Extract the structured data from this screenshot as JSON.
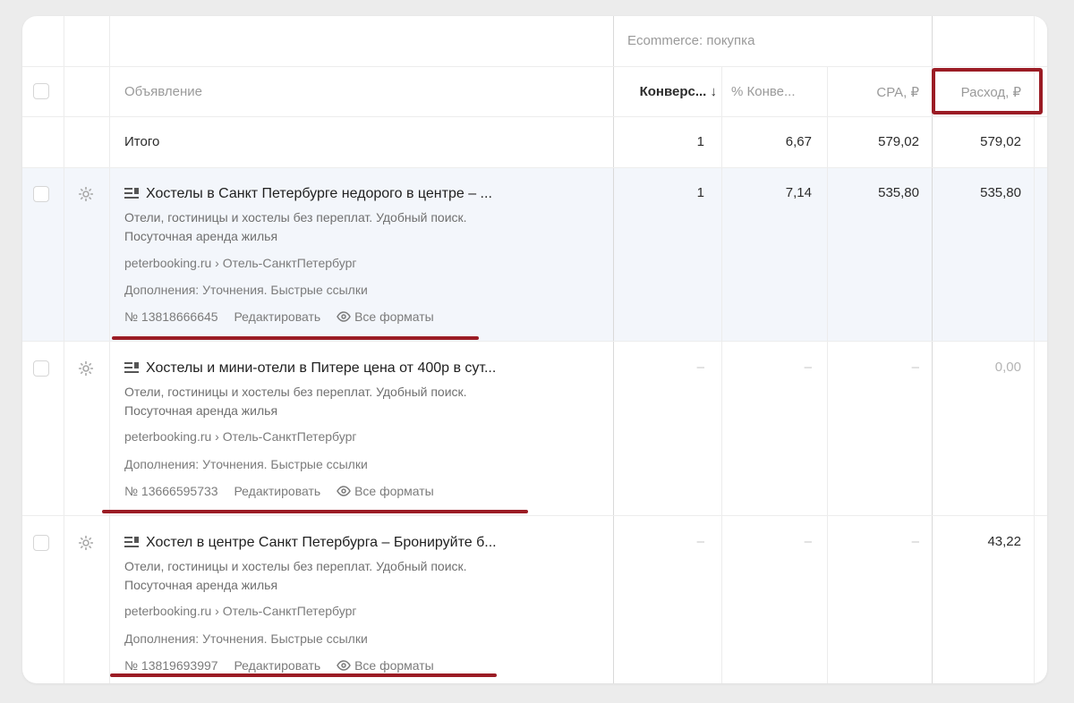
{
  "header": {
    "group_label": "Ecommerce: покупка",
    "col_ad": "Объявление",
    "col_conv": "Конверс... ↓",
    "col_conv_pct": "% Конве...",
    "col_cpa": "CPA, ₽",
    "col_spend": "Расход, ₽"
  },
  "total": {
    "label": "Итого",
    "conv": "1",
    "conv_pct": "6,67",
    "cpa": "579,02",
    "spend": "579,02"
  },
  "rows": [
    {
      "title": "Хостелы в Санкт Петербурге недорого в центре – ...",
      "text": "Отели, гостиницы и хостелы без переплат. Удобный поиск. Посуточная аренда жилья",
      "url": "peterbooking.ru › Отель-СанктПетербург",
      "extensions": "Дополнения: Уточнения. Быстрые ссылки",
      "id": "№ 13818666645",
      "edit": "Редактировать",
      "formats": "Все форматы",
      "conv": "1",
      "conv_pct": "7,14",
      "cpa": "535,80",
      "spend": "535,80"
    },
    {
      "title": "Хостелы и мини-отели в Питере цена от 400р в сут...",
      "text": "Отели, гостиницы и хостелы без переплат. Удобный поиск. Посуточная аренда жилья",
      "url": "peterbooking.ru › Отель-СанктПетербург",
      "extensions": "Дополнения: Уточнения. Быстрые ссылки",
      "id": "№ 13666595733",
      "edit": "Редактировать",
      "formats": "Все форматы",
      "conv": "–",
      "conv_pct": "–",
      "cpa": "–",
      "spend": "0,00"
    },
    {
      "title": "Хостел в центре Санкт Петербурга – Бронируйте б...",
      "text": "Отели, гостиницы и хостелы без переплат. Удобный поиск. Посуточная аренда жилья",
      "url": "peterbooking.ru › Отель-СанктПетербург",
      "extensions": "Дополнения: Уточнения. Быстрые ссылки",
      "id": "№ 13819693997",
      "edit": "Редактировать",
      "formats": "Все форматы",
      "conv": "–",
      "conv_pct": "–",
      "cpa": "–",
      "spend": "43,22"
    }
  ],
  "colors": {
    "highlight": "#9b1c25",
    "row_hover": "#f3f6fb"
  }
}
